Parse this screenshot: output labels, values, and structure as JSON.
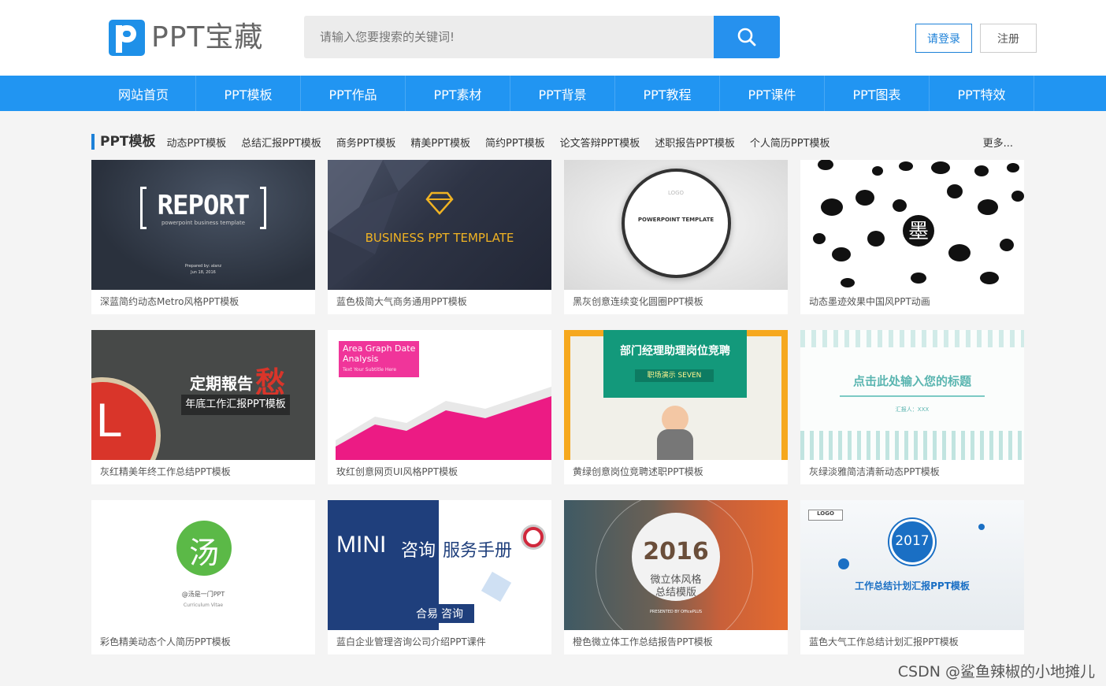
{
  "header": {
    "logo_text": "PPT宝藏",
    "search_placeholder": "请输入您要搜索的关键词!",
    "login_label": "请登录",
    "register_label": "注册"
  },
  "nav": {
    "items": [
      "网站首页",
      "PPT模板",
      "PPT作品",
      "PPT素材",
      "PPT背景",
      "PPT教程",
      "PPT课件",
      "PPT图表",
      "PPT特效"
    ]
  },
  "category": {
    "title": "PPT模板",
    "links": [
      "动态PPT模板",
      "总结汇报PPT模板",
      "商务PPT模板",
      "精美PPT模板",
      "简约PPT模板",
      "论文答辩PPT模板",
      "述职报告PPT模板",
      "个人简历PPT模板"
    ],
    "more": "更多..."
  },
  "cards": [
    {
      "caption": "深蓝简约动态Metro风格PPT模板",
      "t1": "REPORT",
      "t2": "powerpoint business template",
      "t3": "Prepared by: alanz",
      "t4": "Jun 18, 2016"
    },
    {
      "caption": "蓝色极简大气商务通用PPT模板",
      "t1": "BUSINESS PPT TEMPLATE"
    },
    {
      "caption": "黑灰创意连续变化圆圈PPT模板",
      "t1": "POWERPOINT TEMPLATE",
      "t2": "LOGO"
    },
    {
      "caption": "动态墨迹效果中国风PPT动画",
      "t1": "墨"
    },
    {
      "caption": "灰红精美年终工作总结PPT模板",
      "t1": "定期報告",
      "t2": "年底工作汇报PPT模板",
      "t3": "L"
    },
    {
      "caption": "玫红创意网页UI风格PPT模板",
      "t1": "Area Graph Date Analysis",
      "t2": "Text Your Subtitle Here"
    },
    {
      "caption": "黄绿创意岗位竞聘述职PPT模板",
      "t1": "部门经理助理岗位竞聘",
      "t2": "职场演示  SEVEN"
    },
    {
      "caption": "灰绿淡雅简洁清新动态PPT模板",
      "t1": "点击此处输入您的标题",
      "t2": "汇报人：XXX"
    },
    {
      "caption": "彩色精美动态个人简历PPT模板",
      "t1": "汤",
      "t2": "@汤是一门PPT",
      "t3": "Curriculum Vitae"
    },
    {
      "caption": "蓝白企业管理咨询公司介绍PPT课件",
      "t1": "MINI",
      "t2": "咨询",
      "t3": "服务手册",
      "t4": "合易",
      "t5": "咨询"
    },
    {
      "caption": "橙色微立体工作总结报告PPT模板",
      "t1": "2016",
      "t2": "微立体风格",
      "t3": "总结模版",
      "t4": "PRESENTED BY OfficePLUS"
    },
    {
      "caption": "蓝色大气工作总结计划汇报PPT模板",
      "t1": "2017",
      "t2": "工作总结计划汇报PPT模板",
      "t3": "LOGO"
    }
  ],
  "watermark": "CSDN @鲨鱼辣椒的小地摊儿",
  "colors": {
    "brand_blue": "#2195f2",
    "nav_blue": "#2195f2",
    "text": "#333333"
  }
}
